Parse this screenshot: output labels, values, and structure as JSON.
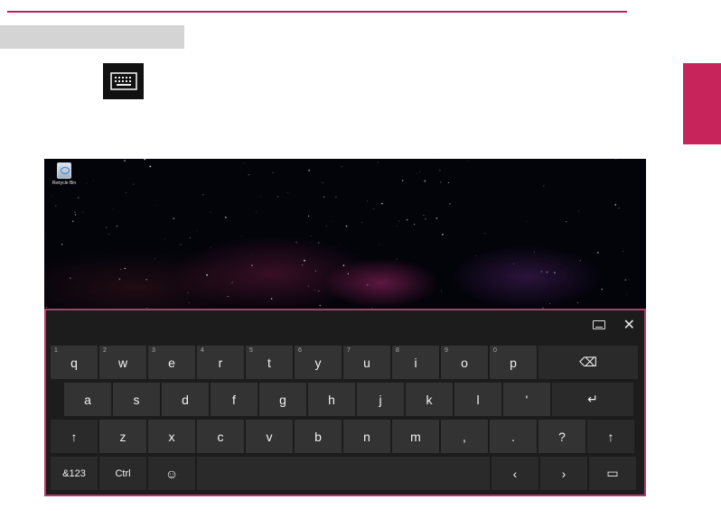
{
  "colors": {
    "accent": "#c8245c",
    "keyboard_bg": "#1c1c1c",
    "key_bg": "#333333",
    "border": "#b53a69"
  },
  "toolbar_icon": "keyboard-icon",
  "desktop": {
    "recycle_bin_label": "Recycle Bin"
  },
  "keyboard": {
    "top_icons": [
      "dock-icon",
      "close-icon"
    ],
    "close_glyph": "✕",
    "rows": [
      [
        {
          "label": "q",
          "num": "1"
        },
        {
          "label": "w",
          "num": "2"
        },
        {
          "label": "e",
          "num": "3"
        },
        {
          "label": "r",
          "num": "4"
        },
        {
          "label": "t",
          "num": "5"
        },
        {
          "label": "y",
          "num": "6"
        },
        {
          "label": "u",
          "num": "7"
        },
        {
          "label": "i",
          "num": "8"
        },
        {
          "label": "o",
          "num": "9"
        },
        {
          "label": "p",
          "num": "0"
        },
        {
          "label": "⌫",
          "icon": "backspace-icon"
        }
      ],
      [
        {
          "label": "a"
        },
        {
          "label": "s"
        },
        {
          "label": "d"
        },
        {
          "label": "f"
        },
        {
          "label": "g"
        },
        {
          "label": "h"
        },
        {
          "label": "j"
        },
        {
          "label": "k"
        },
        {
          "label": "l"
        },
        {
          "label": "'"
        },
        {
          "label": "↵",
          "icon": "enter-icon"
        }
      ],
      [
        {
          "label": "↑",
          "icon": "shift-icon"
        },
        {
          "label": "z"
        },
        {
          "label": "x"
        },
        {
          "label": "c"
        },
        {
          "label": "v"
        },
        {
          "label": "b"
        },
        {
          "label": "n"
        },
        {
          "label": "m"
        },
        {
          "label": ","
        },
        {
          "label": "."
        },
        {
          "label": "?"
        },
        {
          "label": "↑",
          "icon": "shift-icon"
        }
      ],
      [
        {
          "label": "&123"
        },
        {
          "label": "Ctrl"
        },
        {
          "label": "☺",
          "icon": "emoji-icon"
        },
        {
          "label": "",
          "name": "space"
        },
        {
          "label": "‹",
          "icon": "left-arrow-icon"
        },
        {
          "label": "›",
          "icon": "right-arrow-icon"
        },
        {
          "label": "▭",
          "icon": "keyboard-layout-icon"
        }
      ]
    ]
  }
}
